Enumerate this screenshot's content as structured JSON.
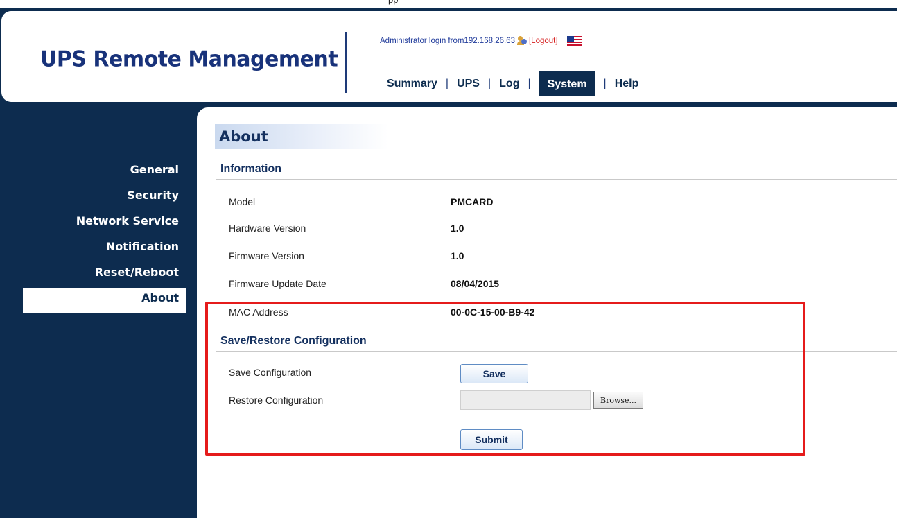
{
  "window": {
    "caption": "pp"
  },
  "header": {
    "logo": "UPS Remote Management",
    "login_text": "Administrator login from192.168.26.63",
    "logout_label": "[Logout]",
    "nav": [
      {
        "label": "Summary",
        "active": false
      },
      {
        "label": "UPS",
        "active": false
      },
      {
        "label": "Log",
        "active": false
      },
      {
        "label": "System",
        "active": true
      },
      {
        "label": "Help",
        "active": false
      }
    ]
  },
  "sidebar": {
    "items": [
      {
        "label": "General",
        "active": false
      },
      {
        "label": "Security",
        "active": false
      },
      {
        "label": "Network Service",
        "active": false
      },
      {
        "label": "Notification",
        "active": false
      },
      {
        "label": "Reset/Reboot",
        "active": false
      },
      {
        "label": "About",
        "active": true
      }
    ]
  },
  "main": {
    "title": "About",
    "information": {
      "heading": "Information",
      "rows": [
        {
          "label": "Model",
          "value": "PMCARD"
        },
        {
          "label": "Hardware Version",
          "value": "1.0"
        },
        {
          "label": "Firmware Version",
          "value": "1.0"
        },
        {
          "label": "Firmware Update Date",
          "value": "08/04/2015"
        },
        {
          "label": "MAC Address",
          "value": "00-0C-15-00-B9-42"
        }
      ]
    },
    "config": {
      "heading": "Save/Restore Configuration",
      "save_label": "Save Configuration",
      "save_button": "Save",
      "restore_label": "Restore Configuration",
      "file_value": "",
      "browse_button": "Browse...",
      "submit_button": "Submit"
    }
  },
  "colors": {
    "navy": "#0d2c4f",
    "highlight_border": "#e51b1b",
    "link_blue": "#1f3a9a",
    "logout_red": "#d62020"
  }
}
